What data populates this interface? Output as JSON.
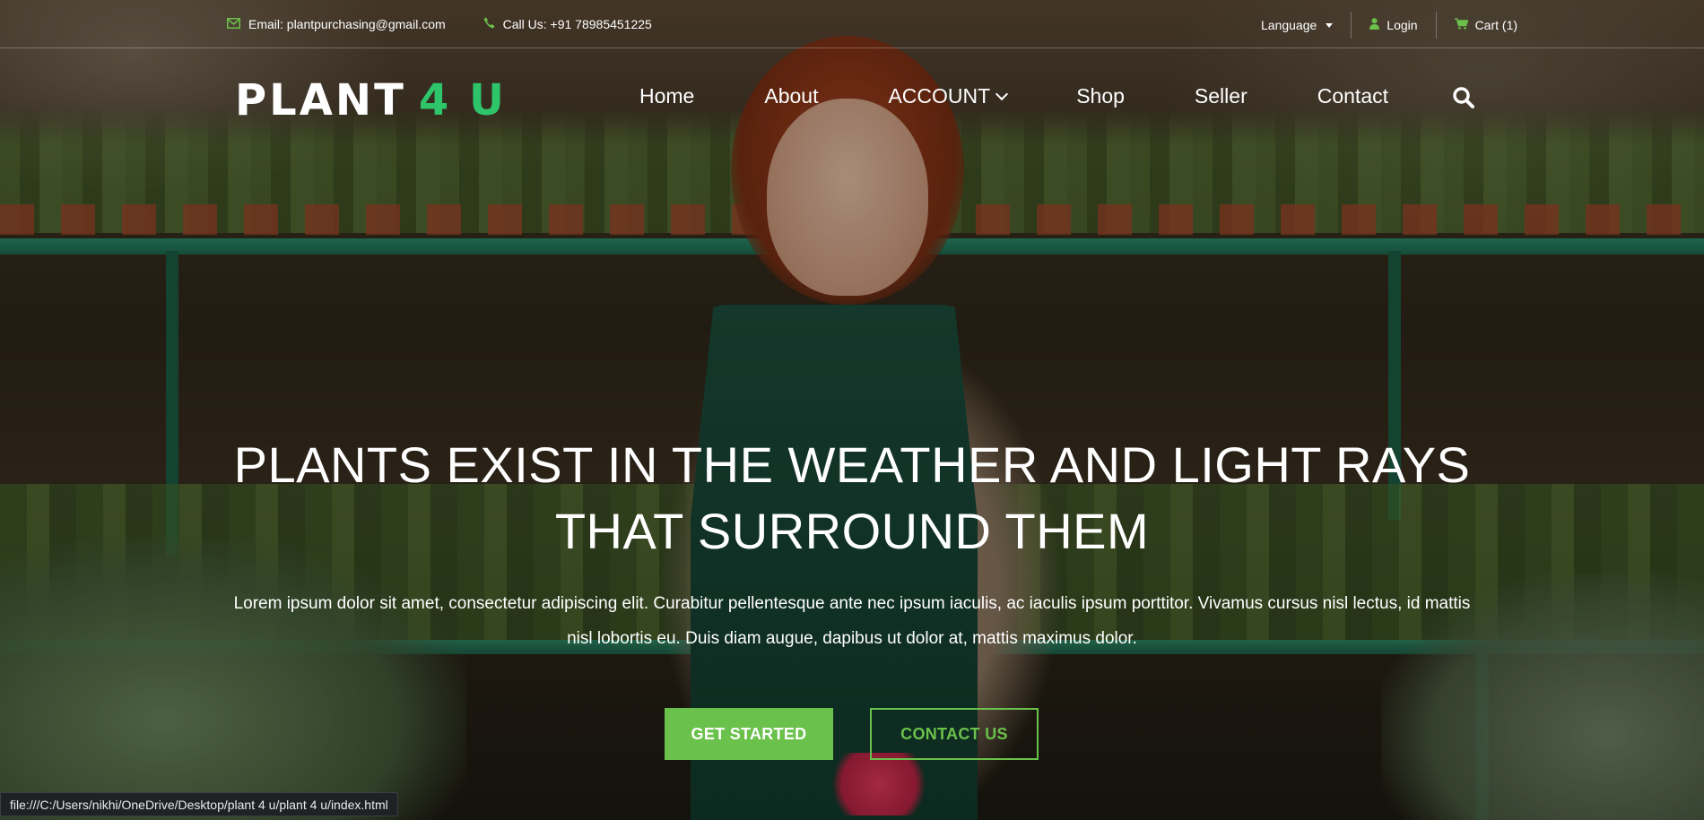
{
  "topbar": {
    "email": "Email: plantpurchasing@gmail.com",
    "phone": "Call Us: +91 78985451225",
    "language": "Language",
    "login": "Login",
    "cart": "Cart (1)"
  },
  "logo": {
    "main": "PLANT",
    "accent": "4 U"
  },
  "nav": {
    "items": [
      "Home",
      "About",
      "ACCOUNT",
      "Shop",
      "Seller",
      "Contact"
    ]
  },
  "hero": {
    "title": "PLANTS EXIST IN THE WEATHER AND LIGHT RAYS THAT SURROUND THEM",
    "description": "Lorem ipsum dolor sit amet, consectetur adipiscing elit. Curabitur pellentesque ante nec ipsum iaculis, ac iaculis ipsum porttitor. Vivamus cursus nisl lectus, id mattis nisl lobortis eu. Duis diam augue, dapibus ut dolor at, mattis maximus dolor.",
    "primary_button": "GET STARTED",
    "secondary_button": "CONTACT US"
  },
  "status_bar": "file:///C:/Users/nikhi/OneDrive/Desktop/plant 4 u/plant 4 u/index.html",
  "colors": {
    "accent_green": "#6ac14b",
    "logo_green": "#2ec46a"
  },
  "icons": [
    "envelope-icon",
    "phone-icon",
    "user-icon",
    "cart-icon",
    "chevron-down-icon",
    "search-icon"
  ]
}
